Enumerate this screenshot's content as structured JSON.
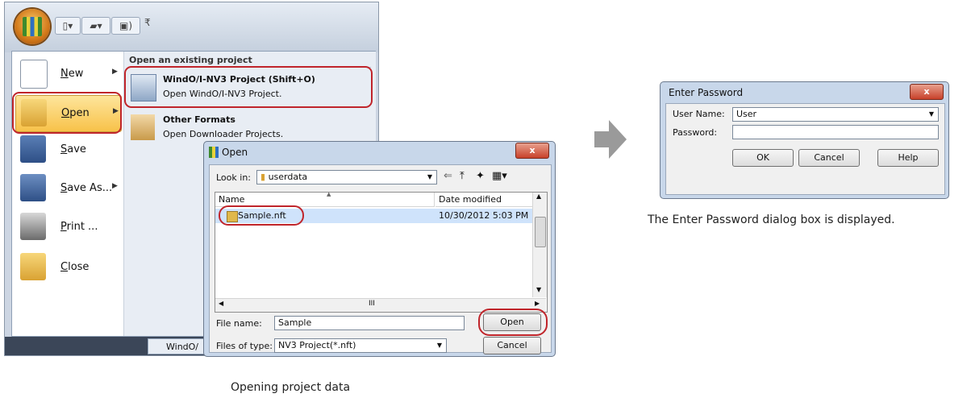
{
  "app_menu": {
    "qat_new": "▾",
    "qat_open": "▾",
    "qat_save": ")",
    "qat_more": "₹",
    "items": [
      {
        "label": "New"
      },
      {
        "label": "Open"
      },
      {
        "label": "Save"
      },
      {
        "label": "Save As..."
      },
      {
        "label": "Print ..."
      },
      {
        "label": "Close"
      }
    ],
    "right_header": "Open an existing project",
    "right_items": [
      {
        "title": "WindO/I-NV3 Project (Shift+O)",
        "desc": "Open WindO/I-NV3 Project."
      },
      {
        "title": "Other Formats",
        "desc": "Open Downloader Projects."
      }
    ],
    "taskbar_button": "WindO/"
  },
  "open_dialog": {
    "title": "Open",
    "close_label": "x",
    "look_in_label": "Look in:",
    "look_in_value": "userdata",
    "columns": [
      "Name",
      "Date modified"
    ],
    "files": [
      {
        "name": "Sample.nft",
        "date": "10/30/2012 5:03 PM"
      }
    ],
    "hscroll_grip": "III",
    "file_name_label": "File name:",
    "file_name_value": "Sample",
    "files_of_type_label": "Files of type:",
    "files_of_type_value": "NV3 Project(*.nft)",
    "open_button": "Open",
    "cancel_button": "Cancel"
  },
  "caption_left": "Opening project data",
  "password_dialog": {
    "title": "Enter Password",
    "close_label": "x",
    "user_name_label": "User Name:",
    "user_name_value": "User",
    "password_label": "Password:",
    "password_value": "",
    "ok_button": "OK",
    "cancel_button": "Cancel",
    "help_button": "Help"
  },
  "caption_right": "The Enter Password dialog box is displayed.",
  "colors": {
    "highlight_red": "#c0252b",
    "arrow_gray": "#9a9a9a"
  }
}
